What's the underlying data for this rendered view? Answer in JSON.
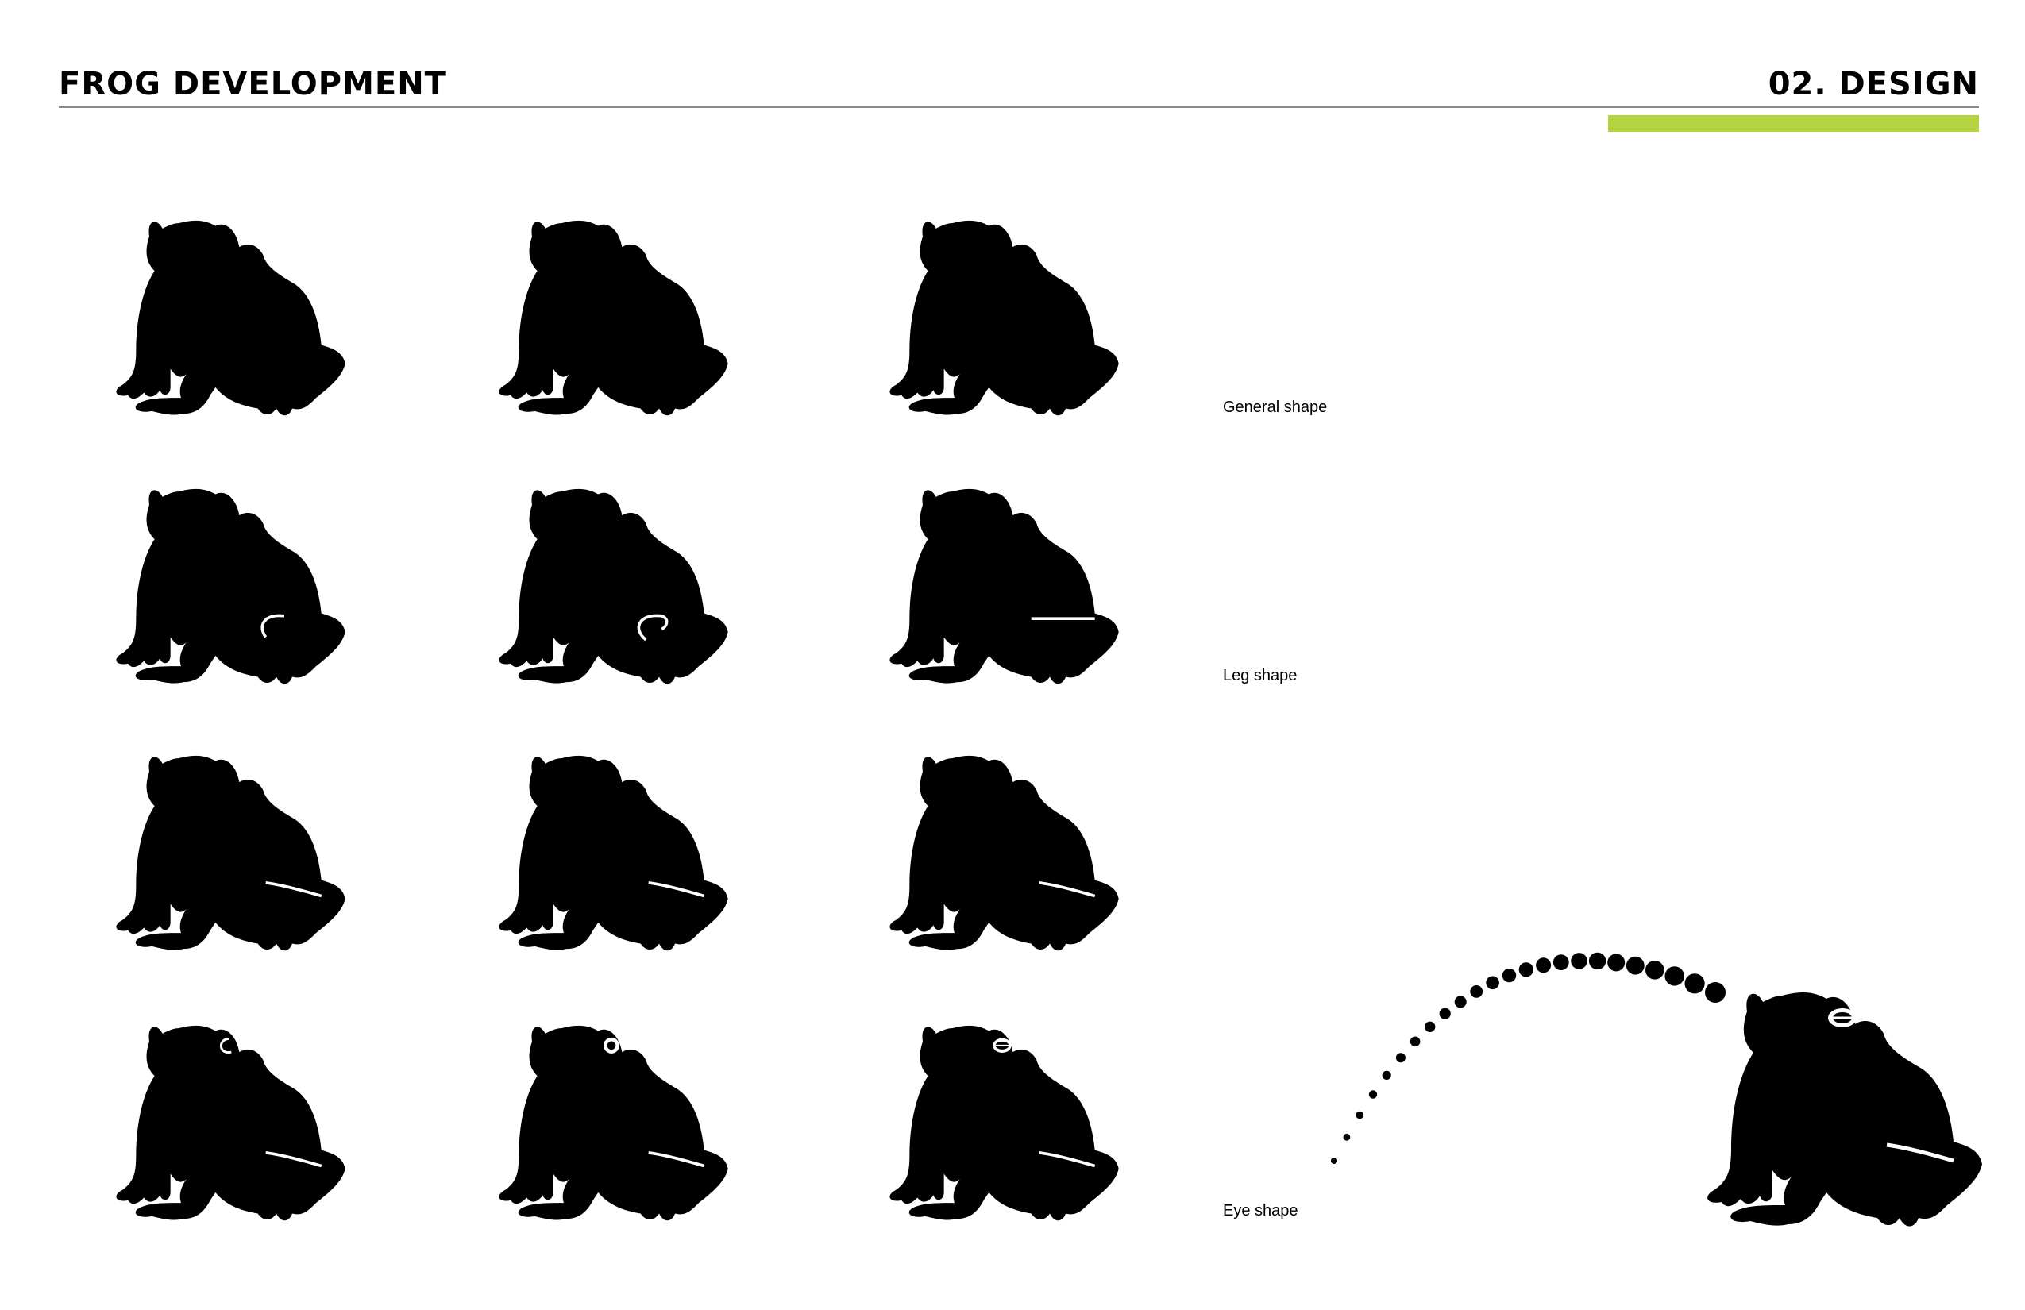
{
  "header": {
    "title": "FROG DEVELOPMENT",
    "section": "02. DESIGN",
    "accent_color": "#b5d33e"
  },
  "rows": [
    {
      "caption": "General shape",
      "variant": "general"
    },
    {
      "caption": "Leg shape",
      "variant": "leg"
    },
    {
      "caption": "",
      "variant": "leg-refined"
    },
    {
      "caption": "Eye shape",
      "variant": "eye"
    }
  ],
  "icons": {
    "frog": "frog-silhouette-icon",
    "leap": "dotted-jump-arc"
  }
}
